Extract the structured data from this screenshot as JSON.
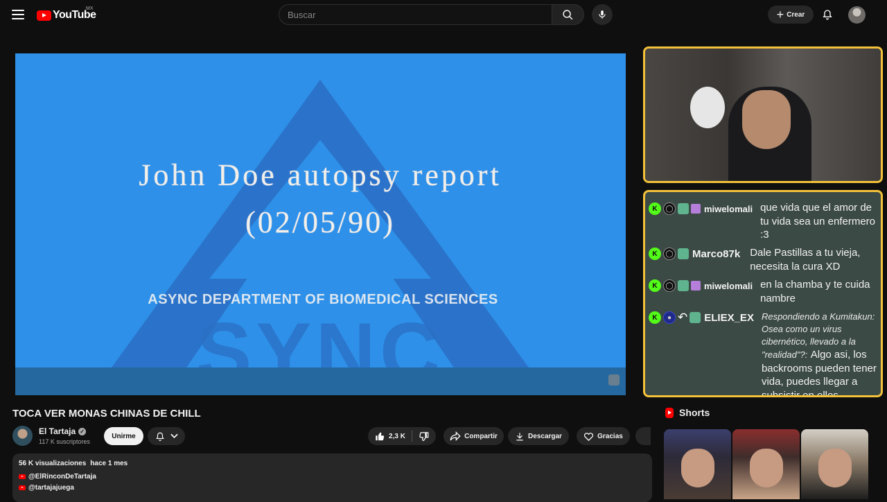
{
  "header": {
    "logo_text": "YouTube",
    "country_code": "MX",
    "search_placeholder": "Buscar",
    "create_label": "Crear"
  },
  "video_frame": {
    "line1": "John Doe autopsy report",
    "line2": "(02/05/90)",
    "line3": "ASYNC DEPARTMENT OF BIOMEDICAL SCIENCES",
    "logo_letters": "SYNC",
    "background_color": "#2e90e8"
  },
  "chat": {
    "messages": [
      {
        "user": "miwelomali",
        "text": "que vida que el amor de tu vida sea un enfermero :3"
      },
      {
        "user": "Marco87k",
        "text": "Dale Pastillas a tu vieja, necesita la cura XD"
      },
      {
        "user": "miwelomali",
        "text": "en la chamba y te cuida nambre"
      },
      {
        "user": "ELIEX_EX",
        "reply": "Respondiendo a Kumitakun: Osea como un virus cibernético, llevado a la \"realidad\"?:",
        "text": "Algo asi, los backrooms pueden tener vida, puedes llegar a subsistir en ellos"
      }
    ],
    "badge_letter": "K",
    "accent_color": "#53fc18",
    "border_color": "#f4c23a"
  },
  "video": {
    "title": "TOCA VER MONAS CHINAS DE CHILL",
    "channel_name": "El Tartaja",
    "subscribers": "117 K suscriptores",
    "join_label": "Unirme",
    "likes": "2,3 K",
    "share_label": "Compartir",
    "download_label": "Descargar",
    "thanks_label": "Gracias"
  },
  "description": {
    "views": "56 K visualizaciones",
    "date": "hace 1 mes",
    "links": [
      "@ElRinconDeTartaja",
      "@tartajajuega"
    ]
  },
  "shorts": {
    "heading": "Shorts"
  }
}
